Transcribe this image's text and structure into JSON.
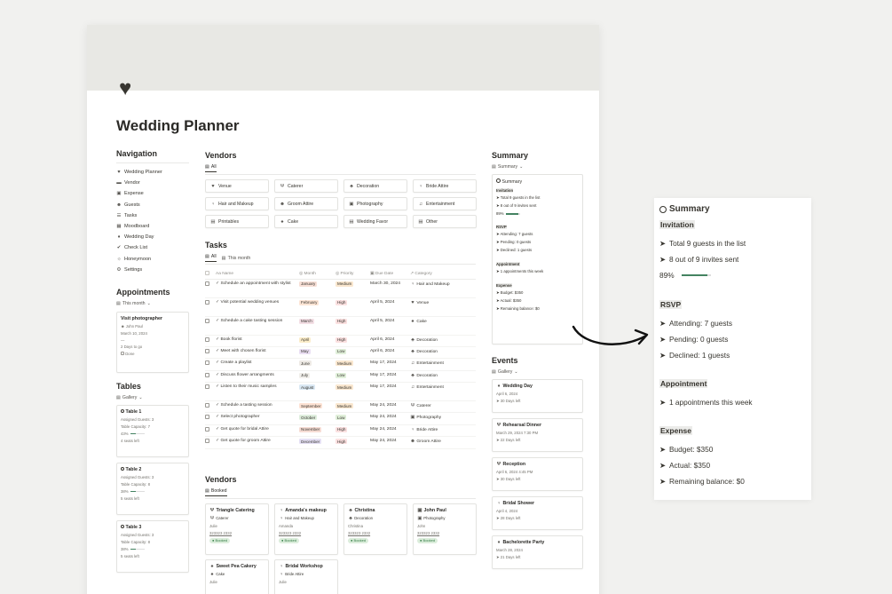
{
  "page": {
    "icon": "heart-icon",
    "title": "Wedding Planner"
  },
  "navigation": {
    "heading": "Navigation",
    "items": [
      {
        "icon": "wedding-planner-icon",
        "glyph": "♥",
        "label": "Wedding Planner"
      },
      {
        "icon": "vendor-icon",
        "glyph": "▬",
        "label": "Vendor"
      },
      {
        "icon": "expense-icon",
        "glyph": "▣",
        "label": "Expense"
      },
      {
        "icon": "guests-icon",
        "glyph": "☻",
        "label": "Guests"
      },
      {
        "icon": "tasks-icon",
        "glyph": "☰",
        "label": "Tasks"
      },
      {
        "icon": "moodboard-icon",
        "glyph": "▦",
        "label": "Moodboard"
      },
      {
        "icon": "wedding-day-icon",
        "glyph": "♦",
        "label": "Wedding Day"
      },
      {
        "icon": "check-list-icon",
        "glyph": "✔",
        "label": "Check List"
      },
      {
        "icon": "honeymoon-icon",
        "glyph": "☼",
        "label": "Honeymoon"
      },
      {
        "icon": "settings-icon",
        "glyph": "⚙",
        "label": "Settings"
      }
    ]
  },
  "appointments": {
    "heading": "Appointments",
    "view": "This month",
    "card": {
      "title": "Visit photographer",
      "person": "John Paul",
      "date": "March 10, 2024",
      "countdown": "2 Days to go",
      "done_label": "Done"
    }
  },
  "tables": {
    "heading": "Tables",
    "view": "Gallery",
    "items": [
      {
        "title": "Table 1",
        "assigned": "Assigned Guests: 3",
        "capacity": "Table Capacity: 7",
        "percent_label": "43%",
        "percent": 0.43,
        "seats": "4 seats left"
      },
      {
        "title": "Table 2",
        "assigned": "Assigned Guests: 3",
        "capacity": "Table Capacity: 8",
        "percent_label": "38%",
        "percent": 0.38,
        "seats": "5 seats left"
      },
      {
        "title": "Table 3",
        "assigned": "Assigned Guests: 3",
        "capacity": "Table Capacity: 8",
        "percent_label": "38%",
        "percent": 0.38,
        "seats": "5 seats left"
      }
    ]
  },
  "vendors": {
    "heading": "Vendors",
    "view": "All",
    "items": [
      {
        "icon": "venue-icon",
        "glyph": "♥",
        "label": "Venue"
      },
      {
        "icon": "caterer-icon",
        "glyph": "Ψ",
        "label": "Caterer"
      },
      {
        "icon": "decoration-icon",
        "glyph": "♣",
        "label": "Decoration"
      },
      {
        "icon": "bride-attire-icon",
        "glyph": "♀",
        "label": "Bride Attire"
      },
      {
        "icon": "hair-makeup-icon",
        "glyph": "♀",
        "label": "Hair and Makeup"
      },
      {
        "icon": "groom-attire-icon",
        "glyph": "☻",
        "label": "Groom Attire"
      },
      {
        "icon": "photography-icon",
        "glyph": "▣",
        "label": "Photography"
      },
      {
        "icon": "entertainment-icon",
        "glyph": "♫",
        "label": "Entertainment"
      },
      {
        "icon": "printables-icon",
        "glyph": "▤",
        "label": "Printables"
      },
      {
        "icon": "cake-icon",
        "glyph": "♠",
        "label": "Cake"
      },
      {
        "icon": "wedding-favor-icon",
        "glyph": "▤",
        "label": "Wedding Favor"
      },
      {
        "icon": "other-icon",
        "glyph": "▤",
        "label": "Other"
      }
    ]
  },
  "tasks": {
    "heading": "Tasks",
    "tabs": [
      "All",
      "This month"
    ],
    "columns": {
      "name": "Name",
      "month": "Month",
      "priority": "Priority",
      "due": "Due Date",
      "category": "Category"
    },
    "rows": [
      {
        "name": "Schedule an appointment with stylist",
        "month": "January",
        "month_color": "#f7dfd6",
        "priority": "Medium",
        "priority_color": "#fae7cf",
        "due": "March 30, 2024",
        "category": "Hair and Makeup",
        "cat_glyph": "♀"
      },
      {
        "name": "Visit potential wedding venues",
        "month": "February",
        "month_color": "#fde5d5",
        "priority": "High",
        "priority_color": "#fbe0e0",
        "due": "April 5, 2024",
        "category": "Venue",
        "cat_glyph": "♥"
      },
      {
        "name": "Schedule a cake tasting session",
        "month": "March",
        "month_color": "#f3dfe5",
        "priority": "High",
        "priority_color": "#fbe0e0",
        "due": "April 5, 2024",
        "category": "Cake",
        "cat_glyph": "♠"
      },
      {
        "name": "Book florist",
        "month": "April",
        "month_color": "#fbecc9",
        "priority": "High",
        "priority_color": "#fbe0e0",
        "due": "April 6, 2024",
        "category": "Decoration",
        "cat_glyph": "♣"
      },
      {
        "name": "Meet with chosen florist",
        "month": "May",
        "month_color": "#eadff3",
        "priority": "Low",
        "priority_color": "#e0efd9",
        "due": "April 6, 2024",
        "category": "Decoration",
        "cat_glyph": "♣"
      },
      {
        "name": "Create a playlist",
        "month": "June",
        "month_color": "#eeeae5",
        "priority": "Medium",
        "priority_color": "#fae7cf",
        "due": "May 17, 2024",
        "category": "Entertainment",
        "cat_glyph": "♫"
      },
      {
        "name": "Discuss flower arrangments",
        "month": "July",
        "month_color": "#f0eeea",
        "priority": "Low",
        "priority_color": "#e0efd9",
        "due": "May 17, 2024",
        "category": "Decoration",
        "cat_glyph": "♣"
      },
      {
        "name": "Listen to their music samples",
        "month": "August",
        "month_color": "#dae8f3",
        "priority": "Medium",
        "priority_color": "#fae7cf",
        "due": "May 17, 2024",
        "category": "Entertainment",
        "cat_glyph": "♫"
      },
      {
        "name": "Schedule a tasting session",
        "month": "September",
        "month_color": "#fde2d3",
        "priority": "Medium",
        "priority_color": "#fae7cf",
        "due": "May 24, 2024",
        "category": "Caterer",
        "cat_glyph": "Ψ"
      },
      {
        "name": "Select photographer",
        "month": "October",
        "month_color": "#dfeedd",
        "priority": "Low",
        "priority_color": "#e0efd9",
        "due": "May 24, 2024",
        "category": "Photography",
        "cat_glyph": "▣"
      },
      {
        "name": "Get quote for bridal Attire",
        "month": "November",
        "month_color": "#f6dcd4",
        "priority": "High",
        "priority_color": "#fbe0e0",
        "due": "May 24, 2024",
        "category": "Bride Attire",
        "cat_glyph": "♀"
      },
      {
        "name": "Get quote for groom Attire",
        "month": "December",
        "month_color": "#e5e0f4",
        "priority": "High",
        "priority_color": "#fbe0e0",
        "due": "May 24, 2024",
        "category": "Groom Attire",
        "cat_glyph": "☻"
      }
    ]
  },
  "booked_vendors": {
    "heading": "Vendors",
    "view": "Booked",
    "cards": [
      {
        "title": "Triangle Catering",
        "glyph": "Ψ",
        "category": "Caterer",
        "contact": "Julie",
        "phone": "323323 2332",
        "status": "Booked"
      },
      {
        "title": "Amanda's makeup",
        "glyph": "♀",
        "category": "Hair and Makeup",
        "contact": "Amanda",
        "phone": "323323 2332",
        "status": "Booked"
      },
      {
        "title": "Christina",
        "glyph": "♣",
        "category": "Decoration",
        "contact": "Christina",
        "phone": "323323 2332",
        "status": "Booked"
      },
      {
        "title": "John Paul",
        "glyph": "▣",
        "category": "Photography",
        "contact": "John",
        "phone": "323323 2332",
        "status": "Booked"
      },
      {
        "title": "Sweet Pea Cakery",
        "glyph": "♠",
        "category": "Cake",
        "contact": "Julie",
        "phone": "",
        "status": ""
      },
      {
        "title": "Bridal Workshop",
        "glyph": "♀",
        "category": "Bride Attire",
        "contact": "Julie",
        "phone": "",
        "status": ""
      }
    ]
  },
  "summary": {
    "heading": "Summary",
    "view": "Summary",
    "card_title": "Summary",
    "invitation": {
      "label": "Invitation",
      "total": "Total 9 guests in the list",
      "sent": "8 out of 9 invites sent",
      "percent_label": "89%",
      "percent": 0.89
    },
    "rsvp": {
      "label": "RSVP",
      "attending": "Attending: 7 guests",
      "pending": "Pending: 0 guests",
      "declined": "Declined: 1 guests"
    },
    "appointment": {
      "label": "Appointment",
      "line": "1 appointments this week"
    },
    "expense": {
      "label": "Expense",
      "budget": "Budget: $350",
      "actual": "Actual: $350",
      "remaining": "Remaining balance: $0"
    }
  },
  "events": {
    "heading": "Events",
    "view": "Gallery",
    "items": [
      {
        "glyph": "♦",
        "title": "Wedding Day",
        "date": "April 6, 2024",
        "left": "30 Days left"
      },
      {
        "glyph": "Ψ",
        "title": "Rehearsal Dinner",
        "date": "March 29, 2024 7:30 PM",
        "left": "22 Days left"
      },
      {
        "glyph": "Ψ",
        "title": "Reception",
        "date": "April 6, 2024 4:45 PM",
        "left": "30 Days left"
      },
      {
        "glyph": "♀",
        "title": "Bridal Shower",
        "date": "April 4, 2024",
        "left": "28 Days left"
      },
      {
        "glyph": "♦",
        "title": "Bachelorette Party",
        "date": "March 28, 2024",
        "left": "21 Days left"
      }
    ]
  },
  "colors": {
    "progress": "#448361",
    "booked_bg": "#dbeddb",
    "booked_fg": "#2f7a42"
  }
}
